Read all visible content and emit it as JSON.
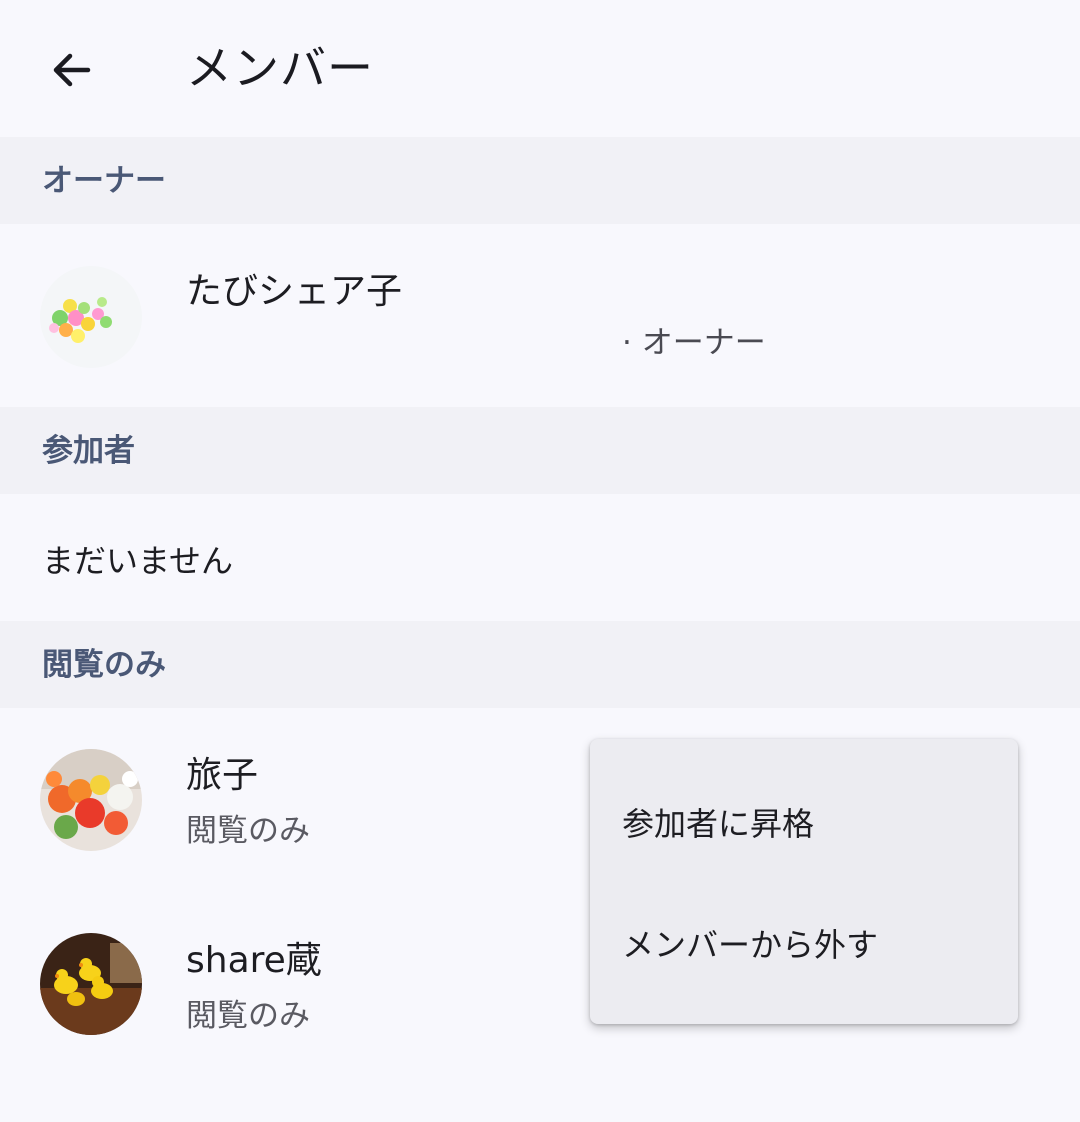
{
  "header": {
    "title": "メンバー",
    "back_icon": "arrow-back-icon"
  },
  "sections": {
    "owner": {
      "label": "オーナー",
      "member": {
        "name": "たびシェア子",
        "role": "· オーナー",
        "avatar": "candy-photo"
      }
    },
    "participants": {
      "label": "参加者",
      "empty_text": "まだいません"
    },
    "viewers": {
      "label": "閲覧のみ",
      "members": [
        {
          "name": "旅子",
          "role": "閲覧のみ",
          "avatar": "flowers-photo"
        },
        {
          "name": "share蔵",
          "role": "閲覧のみ",
          "avatar": "rubber-ducks-photo"
        }
      ]
    }
  },
  "menu": {
    "items": [
      {
        "label": "参加者に昇格"
      },
      {
        "label": "メンバーから外す"
      }
    ]
  },
  "colors": {
    "background": "#f8f8fd",
    "section_header_bg": "#f1f1f6",
    "section_header_text": "#4a5876",
    "menu_bg": "#ececf1"
  }
}
